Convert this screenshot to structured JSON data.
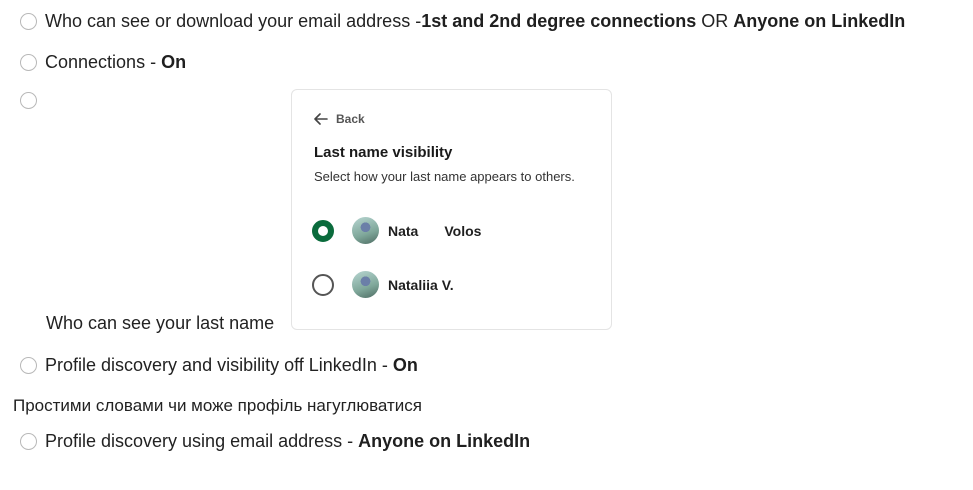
{
  "items": [
    {
      "text": "Who can see or download your email address - ",
      "bold1": "1st and 2nd degree connections",
      "mid": " OR ",
      "bold2": "Anyone on LinkedIn"
    },
    {
      "text": "Connections - ",
      "bold": "On"
    },
    {
      "label": "Who can see your last name"
    },
    {
      "text": "Profile discovery and visibility off LinkedIn - ",
      "bold": "On"
    },
    {
      "text": "Profile discovery using email address - ",
      "bold": "Anyone on LinkedIn"
    }
  ],
  "note": "Простими словами чи може профіль нагуглюватися",
  "panel": {
    "back_label": "Back",
    "title": "Last name visibility",
    "subtitle": "Select how your last name appears to others.",
    "options": [
      {
        "first": "Nata",
        "last": "Volos",
        "selected": true
      },
      {
        "name": "Nataliia V.",
        "selected": false
      }
    ]
  },
  "colors": {
    "selected_radio": "#0a6b3c",
    "text": "#222222"
  }
}
